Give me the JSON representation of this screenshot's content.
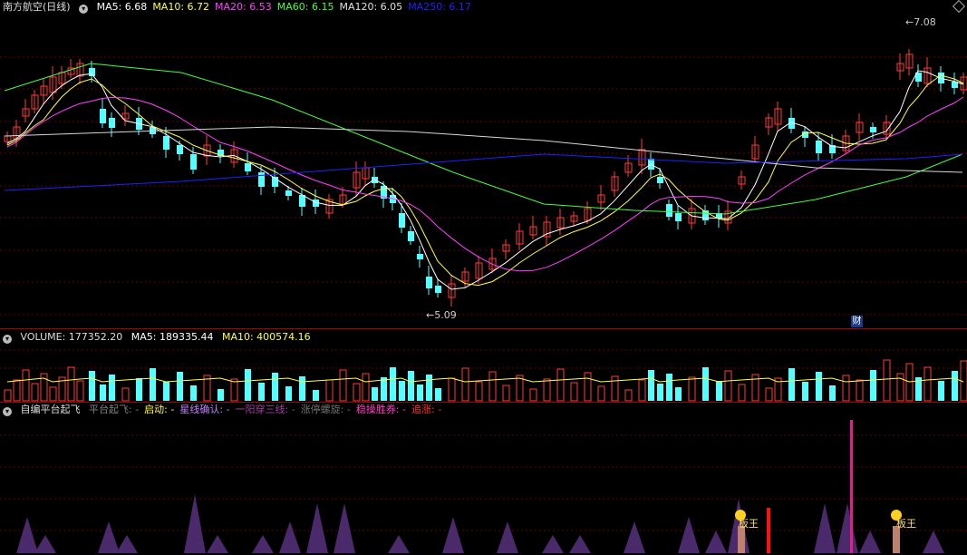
{
  "main": {
    "title": "南方航空(日线)",
    "ma": [
      {
        "label": "MA5:",
        "value": "6.68",
        "color": "#ffffff"
      },
      {
        "label": "MA10:",
        "value": "6.72",
        "color": "#ffff40"
      },
      {
        "label": "MA20:",
        "value": "6.53",
        "color": "#ff40ff"
      },
      {
        "label": "MA60:",
        "value": "6.15",
        "color": "#40ff40"
      },
      {
        "label": "MA120:",
        "value": "6.05",
        "color": "#e0e0e0"
      },
      {
        "label": "MA250:",
        "value": "6.17",
        "color": "#2020ff"
      }
    ],
    "high_label": "7.08",
    "low_label": "5.09",
    "cai_badge": "财"
  },
  "volume": {
    "label": "VOLUME: 177352.20",
    "ma5": "MA5: 189335.44",
    "ma10": "MA10: 400574.16"
  },
  "indicator": {
    "name": "自编平台起飞",
    "items": [
      {
        "text": "平台起飞: -",
        "color": "#808080"
      },
      {
        "text": "启动: -",
        "color": "#ffff40"
      },
      {
        "text": "星线确认: -",
        "color": "#c080ff"
      },
      {
        "text": "一阳穿三线: -",
        "color": "#a040a0"
      },
      {
        "text": "涨停螺旋: -",
        "color": "#707070"
      },
      {
        "text": "稳操胜券: -",
        "color": "#ff40c0"
      },
      {
        "text": "追涨: -",
        "color": "#ff3030"
      }
    ],
    "banwang_label_1": "板王",
    "banwang_label_2": "板王"
  },
  "colors": {
    "up": "#ff3b3b",
    "down": "#54ffff",
    "grid": "#8a0000",
    "bg": "#000000"
  }
}
